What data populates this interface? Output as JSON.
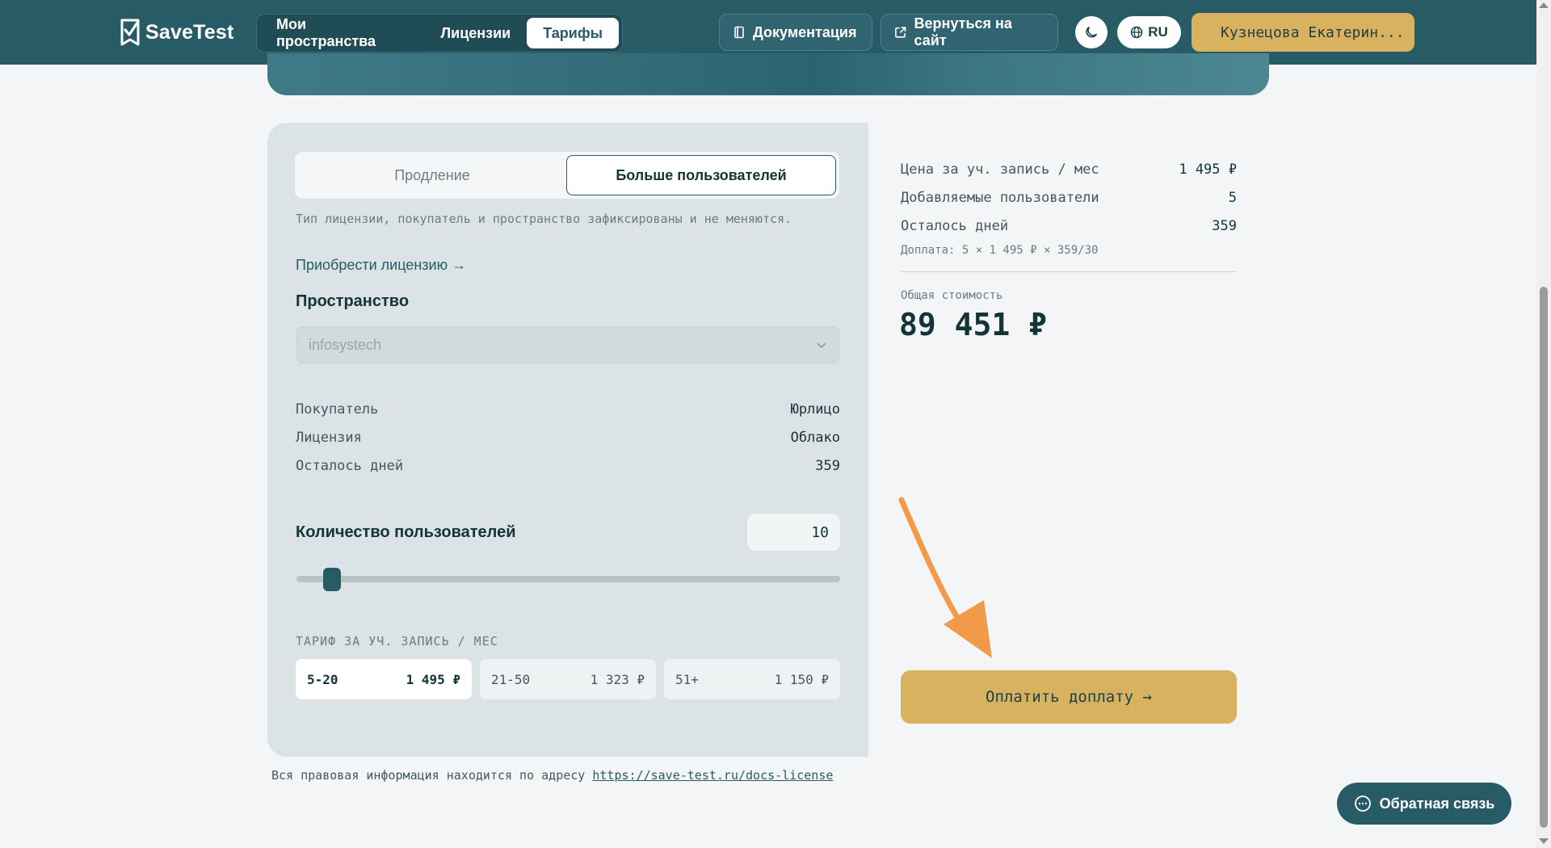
{
  "header": {
    "logo_text": "SaveTest",
    "nav": [
      {
        "label": "Мои пространства",
        "active": false
      },
      {
        "label": "Лицензии",
        "active": false
      },
      {
        "label": "Тарифы",
        "active": true
      }
    ],
    "docs_label": "Документация",
    "back_label": "Вернуться на сайт",
    "lang_label": "RU",
    "user_label": "Кузнецова Екатерин..."
  },
  "tabs": [
    {
      "label": "Продление",
      "active": false
    },
    {
      "label": "Больше пользователей",
      "active": true
    }
  ],
  "hint": "Тип лицензии, покупатель и пространство зафиксированы и не меняются.",
  "buy_link": "Приобрести лицензию →",
  "space": {
    "label": "Пространство",
    "value": "infosystech"
  },
  "info": [
    {
      "label": "Покупатель",
      "value": "Юрлицо"
    },
    {
      "label": "Лицензия",
      "value": "Облако"
    },
    {
      "label": "Осталось дней",
      "value": "359"
    }
  ],
  "users": {
    "label": "Количество пользователей",
    "value": "10",
    "slider_fraction": 0.05
  },
  "tariff": {
    "title": "ТАРИФ ЗА УЧ. ЗАПИСЬ / МЕС",
    "tiers": [
      {
        "range": "5-20",
        "price": "1 495 ₽",
        "active": true
      },
      {
        "range": "21-50",
        "price": "1 323 ₽",
        "active": false
      },
      {
        "range": "51+",
        "price": "1 150 ₽",
        "active": false
      }
    ]
  },
  "summary": {
    "rows": [
      {
        "label": "Цена за уч. запись / мес",
        "value": "1 495 ₽"
      },
      {
        "label": "Добавляемые пользователи",
        "value": "5"
      },
      {
        "label": "Осталось дней",
        "value": "359"
      }
    ],
    "formula": "Доплата: 5 × 1 495 ₽ × 359/30",
    "total_label": "Общая стоимость",
    "total": "89 451 ₽",
    "pay_label": "Оплатить доплату →"
  },
  "legal": {
    "text": "Вся правовая информация находится по адресу",
    "link": "https://save-test.ru/docs-license"
  },
  "feedback_label": "Обратная связь",
  "colors": {
    "primary": "#275b66",
    "accent": "#d9b25f",
    "annotation_arrow": "#f39a4a"
  }
}
